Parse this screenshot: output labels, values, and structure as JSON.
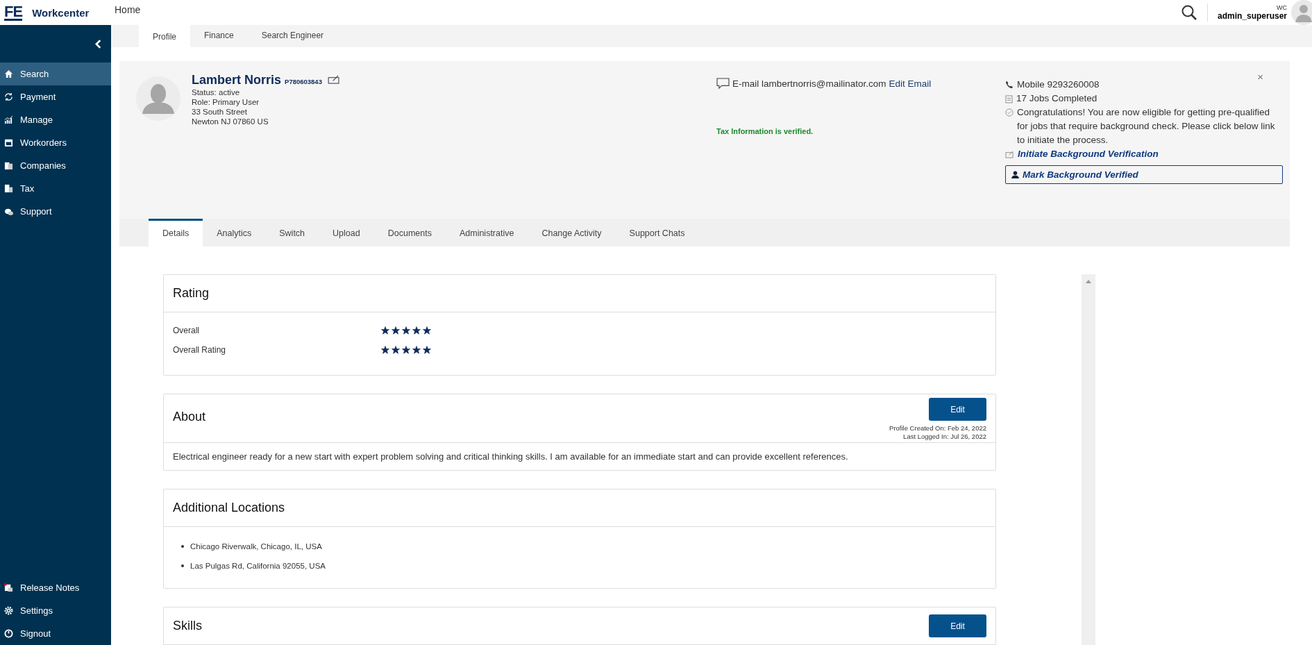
{
  "header": {
    "logo": "FE",
    "app_name": "Workcenter",
    "home_link": "Home",
    "user_short": "WC",
    "user_name": "admin_superuser"
  },
  "sidebar": {
    "items": [
      {
        "label": "Search",
        "selected": true
      },
      {
        "label": "Payment",
        "selected": false
      },
      {
        "label": "Manage",
        "selected": false
      },
      {
        "label": "Workorders",
        "selected": false
      },
      {
        "label": "Companies",
        "selected": false
      },
      {
        "label": "Tax",
        "selected": false
      },
      {
        "label": "Support",
        "selected": false
      }
    ],
    "bottom_items": [
      {
        "label": "Release Notes"
      },
      {
        "label": "Settings"
      },
      {
        "label": "Signout"
      }
    ]
  },
  "top_tabs": [
    {
      "label": "Profile",
      "selected": true
    },
    {
      "label": "Finance",
      "selected": false
    },
    {
      "label": "Search Engineer",
      "selected": false
    }
  ],
  "profile": {
    "name": "Lambert Norris",
    "id": "P780603843",
    "status": "Status: active",
    "role": "Role: Primary User",
    "address_1": "33 South Street",
    "address_2": "Newton NJ 07860 US",
    "email": "E-mail lambertnorris@mailinator.com",
    "edit_email": "Edit Email",
    "tax_note": "Tax Information is verified.",
    "mobile": "Mobile 9293260008",
    "jobs": "17 Jobs Completed",
    "eligibility": "Congratulations! You are now eligible for getting pre-qualified for jobs that require background check. Please click below link to initiate the process.",
    "initiate_link": "Initiate Background Verification",
    "mark_button": "Mark Background Verified",
    "close": "×"
  },
  "detail_tabs": [
    {
      "label": "Details",
      "selected": true
    },
    {
      "label": "Analytics",
      "selected": false
    },
    {
      "label": "Switch",
      "selected": false
    },
    {
      "label": "Upload",
      "selected": false
    },
    {
      "label": "Documents",
      "selected": false
    },
    {
      "label": "Administrative",
      "selected": false
    },
    {
      "label": "Change Activity",
      "selected": false
    },
    {
      "label": "Support Chats",
      "selected": false
    }
  ],
  "rating": {
    "title": "Rating",
    "rows": [
      {
        "label": "Overall",
        "stars": 5
      },
      {
        "label": "Overall Rating",
        "stars": 5
      }
    ]
  },
  "about": {
    "title": "About",
    "edit": "Edit",
    "created": "Profile Created On: Feb 24, 2022",
    "last_login": "Last Logged In: Jul 26, 2022",
    "text": "Electrical engineer ready for a new start with expert problem solving and critical thinking skills. I am available for an immediate start and can provide excellent references."
  },
  "locations": {
    "title": "Additional Locations",
    "items": [
      "Chicago Riverwalk, Chicago, IL, USA",
      "Las Pulgas Rd, California 92055, USA"
    ]
  },
  "skills": {
    "title": "Skills",
    "edit": "Edit"
  }
}
